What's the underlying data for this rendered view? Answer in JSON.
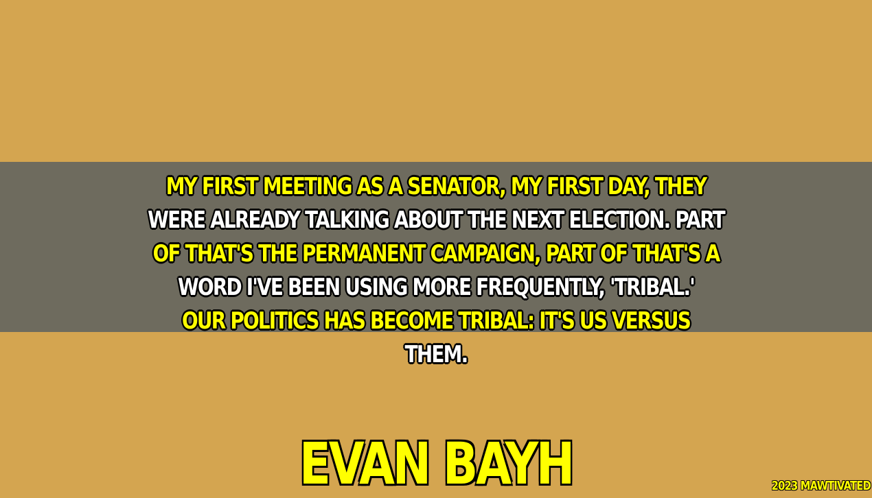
{
  "quote": {
    "lines": [
      "MY FIRST MEETING AS A SENATOR, MY FIRST DAY, THEY",
      "WERE ALREADY TALKING ABOUT THE NEXT ELECTION. PART",
      "OF THAT'S THE PERMANENT CAMPAIGN, PART OF THAT'S A",
      "WORD I'VE BEEN USING MORE FREQUENTLY, 'TRIBAL.'",
      "OUR POLITICS HAS BECOME TRIBAL: IT'S US VERSUS",
      "THEM."
    ]
  },
  "author": "EVAN BAYH",
  "credit": "2023 MAWTIVATED",
  "colors": {
    "background": "#d4a550",
    "band": "#6e6b5e",
    "highlight_text": "#ffff00",
    "plain_text": "#ffffff",
    "outline": "#000000"
  }
}
